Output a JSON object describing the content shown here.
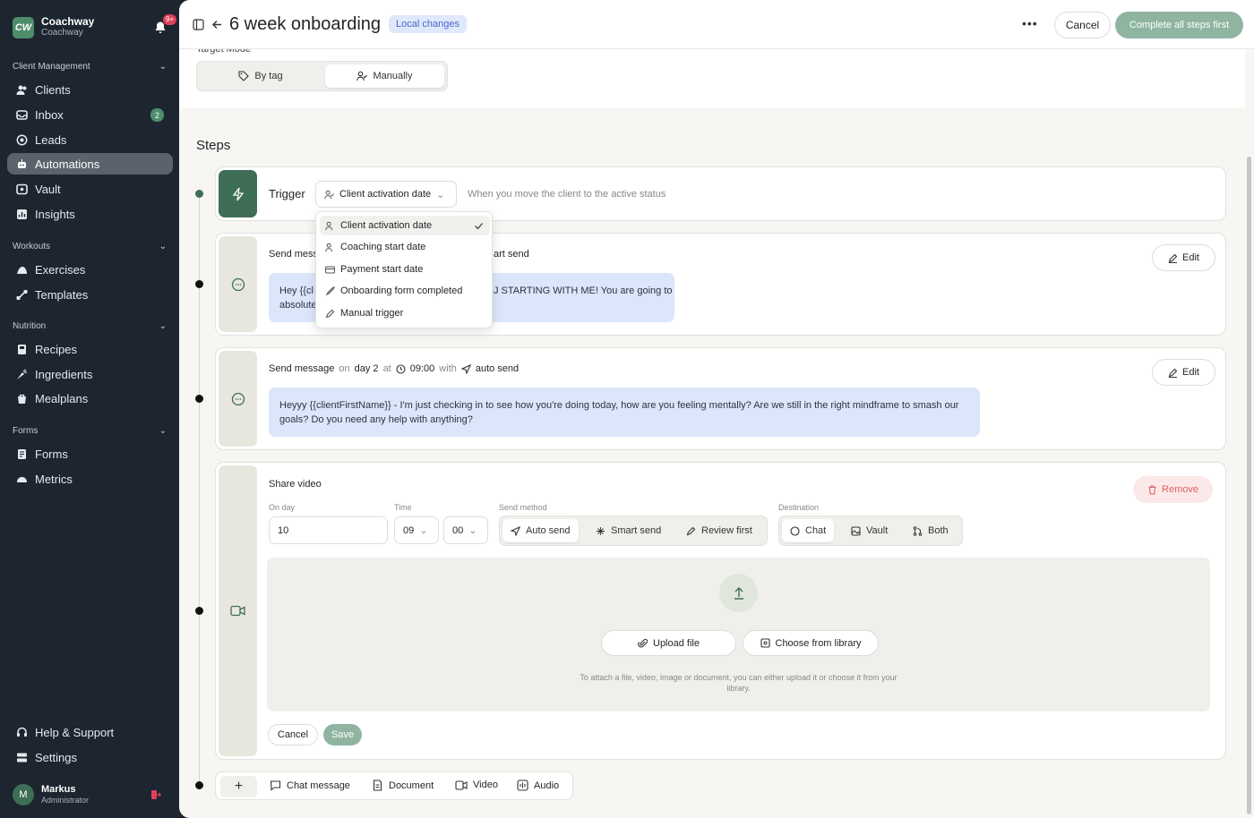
{
  "sidebar": {
    "brand_name": "Coachway",
    "brand_sub": "Coachway",
    "brand_logo": "CW",
    "notif_badge": "9+",
    "sections": [
      {
        "label": "Client Management"
      },
      {
        "label": "Workouts"
      },
      {
        "label": "Nutrition"
      },
      {
        "label": "Forms"
      }
    ],
    "items": {
      "clients": "Clients",
      "inbox": "Inbox",
      "inbox_badge": "2",
      "leads": "Leads",
      "automations": "Automations",
      "vault": "Vault",
      "insights": "Insights",
      "exercises": "Exercises",
      "templates": "Templates",
      "recipes": "Recipes",
      "ingredients": "Ingredients",
      "mealplans": "Mealplans",
      "forms": "Forms",
      "metrics": "Metrics",
      "help": "Help & Support",
      "settings": "Settings"
    },
    "user": {
      "initial": "M",
      "name": "Markus",
      "role": "Administrator"
    }
  },
  "header": {
    "title": "6 week onboarding",
    "badge": "Local changes",
    "more": "•••",
    "cancel": "Cancel",
    "complete": "Complete all steps first"
  },
  "target": {
    "label": "Target Mode",
    "by_tag": "By tag",
    "manually": "Manually"
  },
  "steps_heading": "Steps",
  "trigger": {
    "label": "Trigger",
    "selected": "Client activation date",
    "hint": "When you move the client to the active status",
    "options": [
      "Client activation date",
      "Coaching start date",
      "Payment start date",
      "Onboarding form completed",
      "Manual trigger"
    ]
  },
  "step1": {
    "title_prefix": "Send mess",
    "title_suffix": "art send",
    "message_a": "Hey {{cl",
    "message_b": "absolute",
    "message_c": "J STARTING WITH ME! You are going to",
    "edit": "Edit"
  },
  "step2": {
    "label": "Send message",
    "on": "on",
    "day": "day 2",
    "at": "at",
    "time": "09:00",
    "with": "with",
    "method": "auto send",
    "message": "Heyyy {{clientFirstName}} - I'm just checking in to see how you're doing today, how are you feeling mentally? Are we still in the right mindframe to smash our goals? Do you need any help with anything?",
    "edit": "Edit"
  },
  "step3": {
    "label": "Share video",
    "remove": "Remove",
    "on_day_label": "On day",
    "on_day_value": "10",
    "time_label": "Time",
    "hour": "09",
    "minute": "00",
    "send_method_label": "Send method",
    "send_methods": [
      "Auto send",
      "Smart send",
      "Review first"
    ],
    "destination_label": "Destination",
    "destinations": [
      "Chat",
      "Vault",
      "Both"
    ],
    "upload": "Upload file",
    "library": "Choose from library",
    "hint": "To attach a file, video, image or document, you can either upload it or choose it from your library.",
    "cancel": "Cancel",
    "save": "Save"
  },
  "add_bar": {
    "plus": "+",
    "chat": "Chat message",
    "document": "Document",
    "video": "Video",
    "audio": "Audio"
  },
  "colors": {
    "sidebar_bg": "#1c2530",
    "accent_green": "#3e6e55",
    "complete_btn": "#8fb5a1",
    "message_bubble": "#dce6fb",
    "remove_bg": "#fbe9e9"
  }
}
